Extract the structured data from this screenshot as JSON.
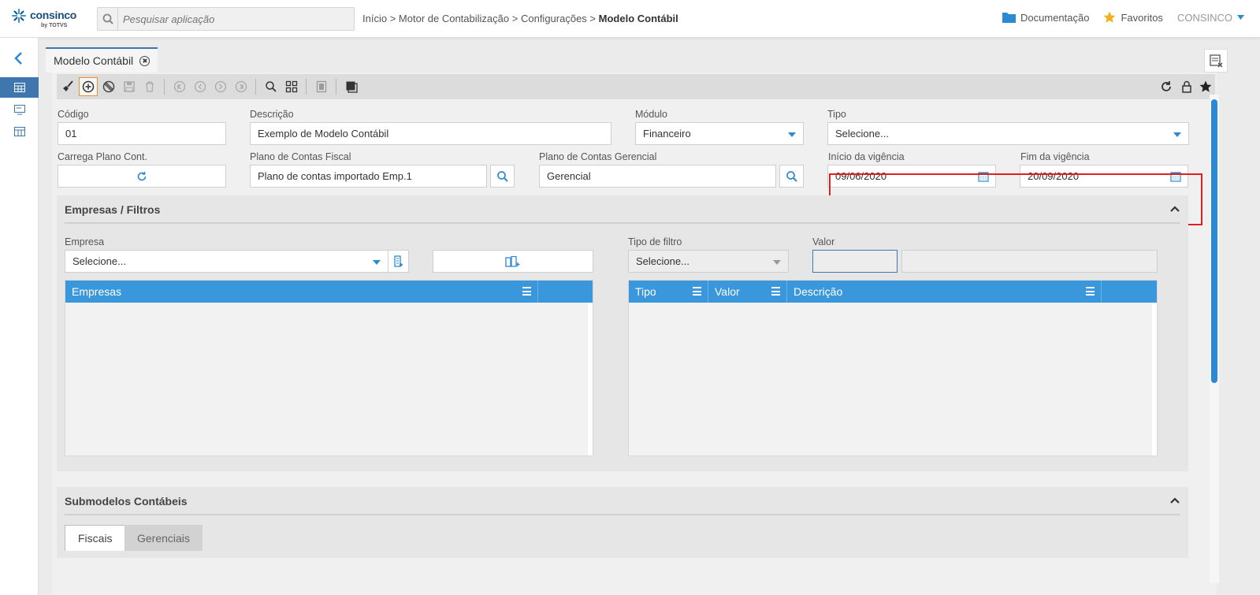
{
  "header": {
    "logo_text": "consinco",
    "logo_sub": "by TOTVS",
    "search_placeholder": "Pesquisar aplicação",
    "breadcrumb": [
      "Início",
      "Motor de Contabilização",
      "Configurações",
      "Modelo Contábil"
    ],
    "breadcrumb_sep": ">",
    "documentation": "Documentação",
    "favorites": "Favoritos",
    "user": "CONSINCO",
    "colors": {
      "accent": "#2a8ad4",
      "folder": "#2a8ad4",
      "star": "#f2b01e"
    }
  },
  "tab": {
    "title": "Modelo Contábil"
  },
  "form": {
    "codigo_label": "Código",
    "codigo_value": "01",
    "descricao_label": "Descrição",
    "descricao_value": "Exemplo de Modelo Contábil",
    "modulo_label": "Módulo",
    "modulo_value": "Financeiro",
    "tipo_label": "Tipo",
    "tipo_value": "Selecione...",
    "carrega_label": "Carrega Plano Cont.",
    "plano_fiscal_label": "Plano de Contas Fiscal",
    "plano_fiscal_value": "Plano de contas importado Emp.1",
    "plano_gerencial_label": "Plano de Contas Gerencial",
    "plano_gerencial_value": "Gerencial",
    "inicio_label": "Início da vigência",
    "inicio_value": "09/06/2020",
    "fim_label": "Fim da vigência",
    "fim_value": "20/09/2020"
  },
  "empresas_section": {
    "title": "Empresas / Filtros",
    "empresa_label": "Empresa",
    "empresa_value": "Selecione...",
    "tipo_filtro_label": "Tipo de filtro",
    "tipo_filtro_value": "Selecione...",
    "valor_label": "Valor",
    "grid_left": {
      "columns": [
        "Empresas"
      ]
    },
    "grid_right": {
      "columns": [
        "Tipo",
        "Valor",
        "Descrição"
      ]
    },
    "grid_header_color": "#3a97dc"
  },
  "submodelos_section": {
    "title": "Submodelos Contábeis",
    "tabs": [
      "Fiscais",
      "Gerenciais"
    ],
    "active_tab": "Fiscais"
  }
}
